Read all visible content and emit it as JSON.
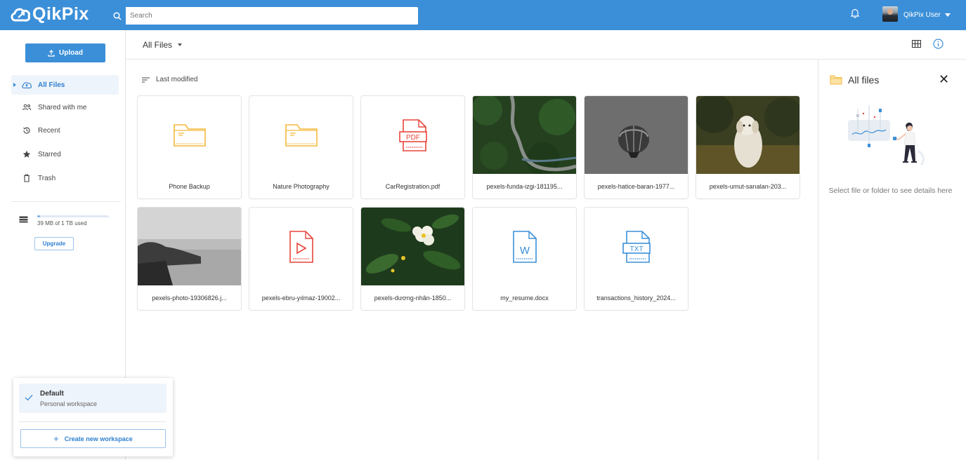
{
  "app": {
    "logo": "QikPix",
    "search_placeholder": "Search",
    "user_name": "QikPix User"
  },
  "sidebar": {
    "upload_label": "Upload",
    "items": [
      {
        "label": "All Files",
        "icon": "cloud-upload-icon",
        "active": true
      },
      {
        "label": "Shared with me",
        "icon": "people-icon",
        "active": false
      },
      {
        "label": "Recent",
        "icon": "history-icon",
        "active": false
      },
      {
        "label": "Starred",
        "icon": "star-icon",
        "active": false
      },
      {
        "label": "Trash",
        "icon": "trash-icon",
        "active": false
      }
    ],
    "storage": {
      "text": "39 MB of 1 TB used",
      "used_fraction": 0.04
    },
    "upgrade_label": "Upgrade"
  },
  "workspace": {
    "name": "Default",
    "subtitle": "Personal workspace",
    "create_label": "Create new workspace"
  },
  "main": {
    "breadcrumb": "All Files",
    "sort_label": "Last modified",
    "files": [
      {
        "name": "Phone Backup",
        "type": "folder"
      },
      {
        "name": "Nature Photography",
        "type": "folder"
      },
      {
        "name": "CarRegistration.pdf",
        "type": "pdf"
      },
      {
        "name": "pexels-funda-izgi-181195...",
        "type": "image-road"
      },
      {
        "name": "pexels-hatice-baran-1977...",
        "type": "image-balloon"
      },
      {
        "name": "pexels-umut-sarıalan-203...",
        "type": "image-dog"
      },
      {
        "name": "pexels-photo-19306826.j...",
        "type": "image-coast"
      },
      {
        "name": "pexels-ebru-yılmaz-19002...",
        "type": "video"
      },
      {
        "name": "pexels-dương-nhân-1850...",
        "type": "image-flower"
      },
      {
        "name": "my_resume.docx",
        "type": "docx"
      },
      {
        "name": "transactions_history_2024...",
        "type": "txt"
      }
    ]
  },
  "details": {
    "title": "All files",
    "message": "Select file or folder to see details here"
  },
  "colors": {
    "brand": "#3b8fd8",
    "folder": "#f4b93c",
    "pdf": "#e8453c",
    "docx": "#3b8fd8"
  }
}
